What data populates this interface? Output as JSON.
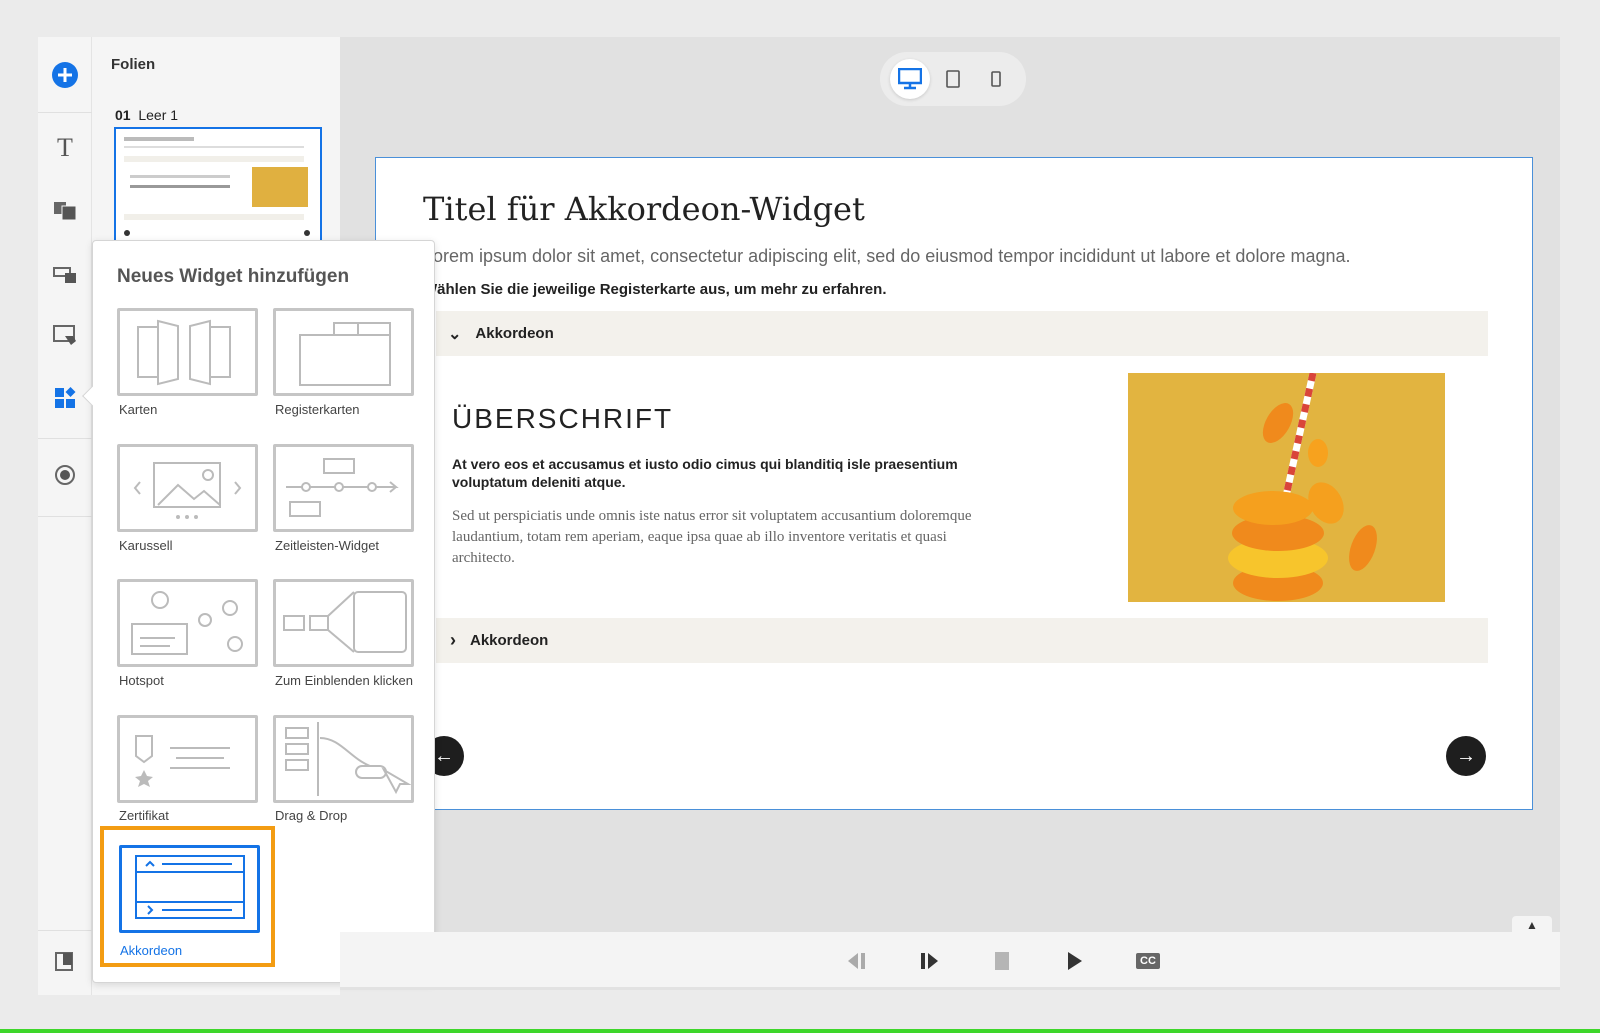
{
  "rail": {
    "icons": [
      "add-icon",
      "text-icon",
      "media-icon",
      "quiz-icon",
      "interaction-icon",
      "widgets-icon",
      "record-icon",
      "slides-panel-icon"
    ]
  },
  "slides_panel": {
    "title": "Folien",
    "slide": {
      "number": "01",
      "name": "Leer 1"
    }
  },
  "device_toggle": [
    "desktop",
    "tablet",
    "mobile"
  ],
  "slide": {
    "title": "Titel für Akkordeon-Widget",
    "intro": "Lorem ipsum dolor sit amet, consectetur adipiscing elit, sed do eiusmod tempor incididunt ut labore et dolore magna.",
    "instruction": "Wählen Sie die jeweilige Registerkarte aus, um mehr zu erfahren.",
    "accordion": [
      {
        "label": "Akkordeon",
        "expanded": true,
        "heading": "ÜBERSCHRIFT",
        "bold": "At vero eos et accusamus et iusto odio cimus qui blanditiq isle praesentium voluptatum deleniti atque.",
        "body": "Sed ut perspiciatis unde omnis iste natus error sit voluptatem accusantium doloremque laudantium, totam rem aperiam, eaque ipsa quae ab illo inventore veritatis et quasi architecto."
      },
      {
        "label": "Akkordeon",
        "expanded": false
      }
    ]
  },
  "popup": {
    "title": "Neues Widget hinzufügen",
    "widgets": [
      "Karten",
      "Registerkarten",
      "Karussell",
      "Zeitleisten-Widget",
      "Hotspot",
      "Zum Einblenden klicken",
      "Zertifikat",
      "Drag & Drop",
      "Akkordeon"
    ],
    "selected": "Akkordeon"
  },
  "playbar": {
    "buttons": [
      "previous",
      "next",
      "stop",
      "play",
      "closed-captions"
    ],
    "cc_label": "CC"
  },
  "colors": {
    "accent": "#1473e6",
    "highlight": "#f39c12"
  }
}
